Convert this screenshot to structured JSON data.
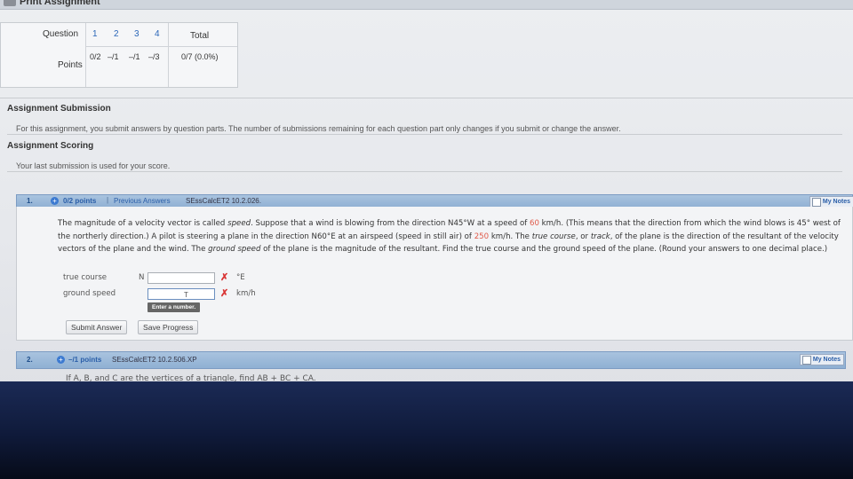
{
  "header": {
    "print_label": "Print Assignment"
  },
  "score_table": {
    "question_label": "Question",
    "points_label": "Points",
    "total_label": "Total",
    "questions": [
      "1",
      "2",
      "3",
      "4"
    ],
    "scores": [
      "0/2",
      "–/1",
      "–/1",
      "–/3"
    ],
    "total_value": "0/7 (0.0%)"
  },
  "submission": {
    "title": "Assignment Submission",
    "text": "For this assignment, you submit answers by question parts. The number of submissions remaining for each question part only changes if you submit or change the answer."
  },
  "scoring": {
    "title": "Assignment Scoring",
    "text": "Your last submission is used for your score."
  },
  "question1": {
    "number": "1.",
    "points": "0/2 points",
    "separator": "|",
    "previous_answers": "Previous Answers",
    "code": "SEssCalcET2 10.2.026.",
    "my_notes": "My Notes",
    "problem": {
      "t1": "The magnitude of a velocity vector is called ",
      "t2": "speed",
      "t3": ". Suppose that a wind is blowing from the direction N45°W at a speed of ",
      "speed_value": "60",
      "t4": " km/h. (This means that the direction from which the wind blows is 45° west of the northerly direction.) A pilot is steering a plane in the direction N60°E at an airspeed (speed in still air) of ",
      "airspeed_value": "250",
      "t5": " km/h. The ",
      "t6": "true course",
      "t7": ", or ",
      "t8": "track",
      "t9": ", of the plane is the direction of the resultant of the velocity vectors of the plane and the wind. The ",
      "t10": "ground speed",
      "t11": " of the plane is the magnitude of the resultant. Find the true course and the ground speed of the plane. (Round your answers to one decimal place.)"
    },
    "true_course_label": "true course",
    "true_course_prefix": "N",
    "true_course_unit": "°E",
    "ground_speed_label": "ground speed",
    "ground_speed_unit": "km/h",
    "tooltip": "Enter a number.",
    "submit_label": "Submit Answer",
    "save_label": "Save Progress"
  },
  "question2": {
    "number": "2.",
    "points": "–/1 points",
    "code": "SEssCalcET2 10.2.506.XP",
    "my_notes": "My Notes",
    "text_preview": "If A, B, and C are the vertices of a triangle, find AB + BC + CA."
  },
  "colors": {
    "link_blue": "#2a5ea8",
    "error_red": "#d93535",
    "highlight_red": "#e05a4a",
    "question_bar": "#9bb9da"
  }
}
